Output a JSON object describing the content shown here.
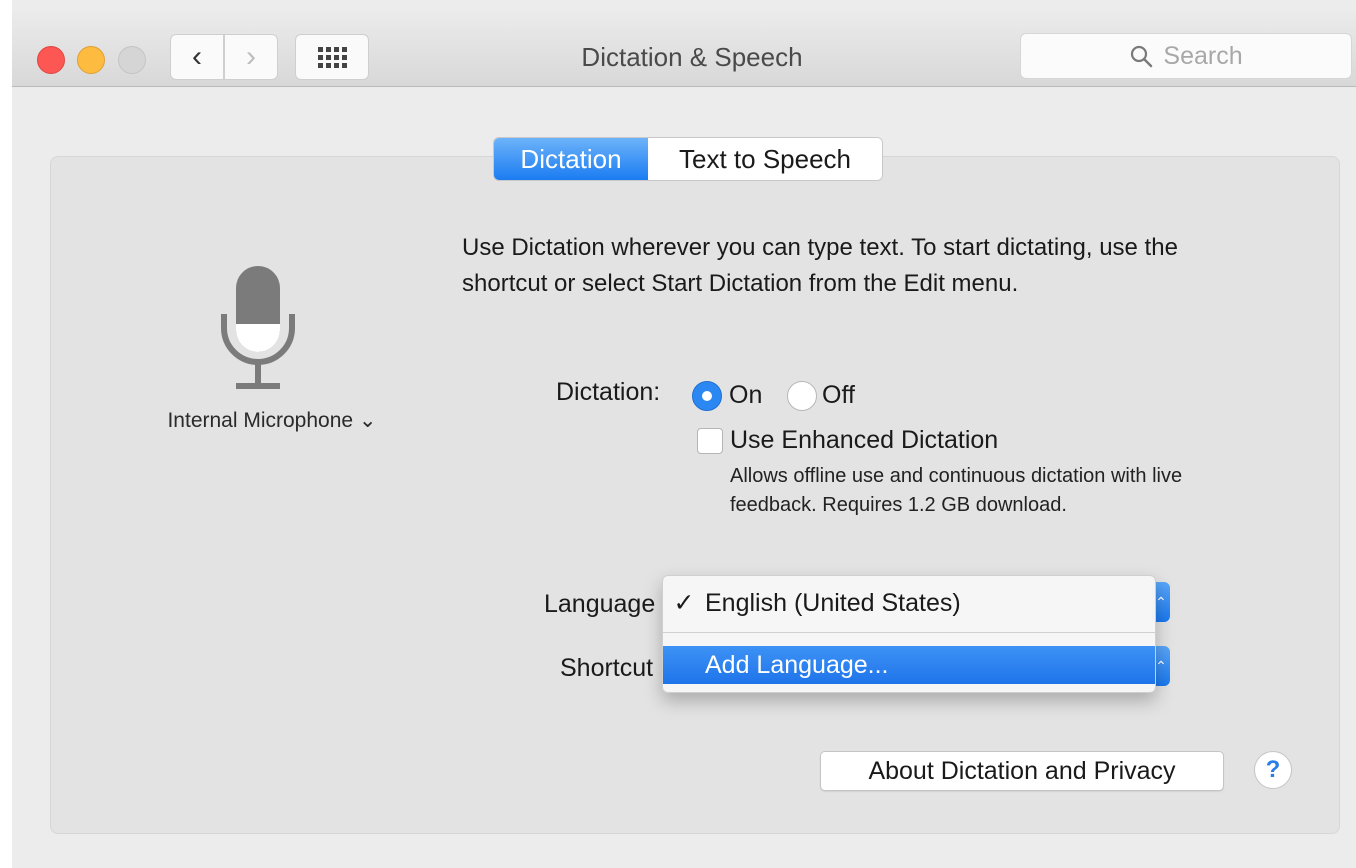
{
  "window": {
    "title": "Dictation & Speech",
    "search_placeholder": "Search",
    "back_glyph": "‹",
    "forward_glyph": "›"
  },
  "tabs": [
    {
      "label": "Dictation",
      "selected": true
    },
    {
      "label": "Text to Speech",
      "selected": false
    }
  ],
  "microphone": {
    "icon": "microphone-icon",
    "label": "Internal Microphone",
    "chevron": "⌄"
  },
  "description": "Use Dictation wherever you can type text. To start dictating, use the shortcut or select Start Dictation from the Edit menu.",
  "dictation": {
    "label": "Dictation:",
    "on_label": "On",
    "off_label": "Off",
    "selected": "On"
  },
  "enhanced": {
    "label": "Use Enhanced Dictation",
    "checked": false,
    "help": "Allows offline use and continuous dictation with live feedback. Requires 1.2 GB download."
  },
  "language": {
    "label": "Language",
    "menu": {
      "check_glyph": "✓",
      "selected_option": "English (United States)",
      "highlighted_option": "Add Language..."
    }
  },
  "shortcut": {
    "label": "Shortcut"
  },
  "about_button": "About Dictation and Privacy",
  "help_button": "?",
  "colors": {
    "accent": "#2b88f3",
    "window_bg": "#ececec",
    "panel_bg": "#e3e3e3"
  }
}
